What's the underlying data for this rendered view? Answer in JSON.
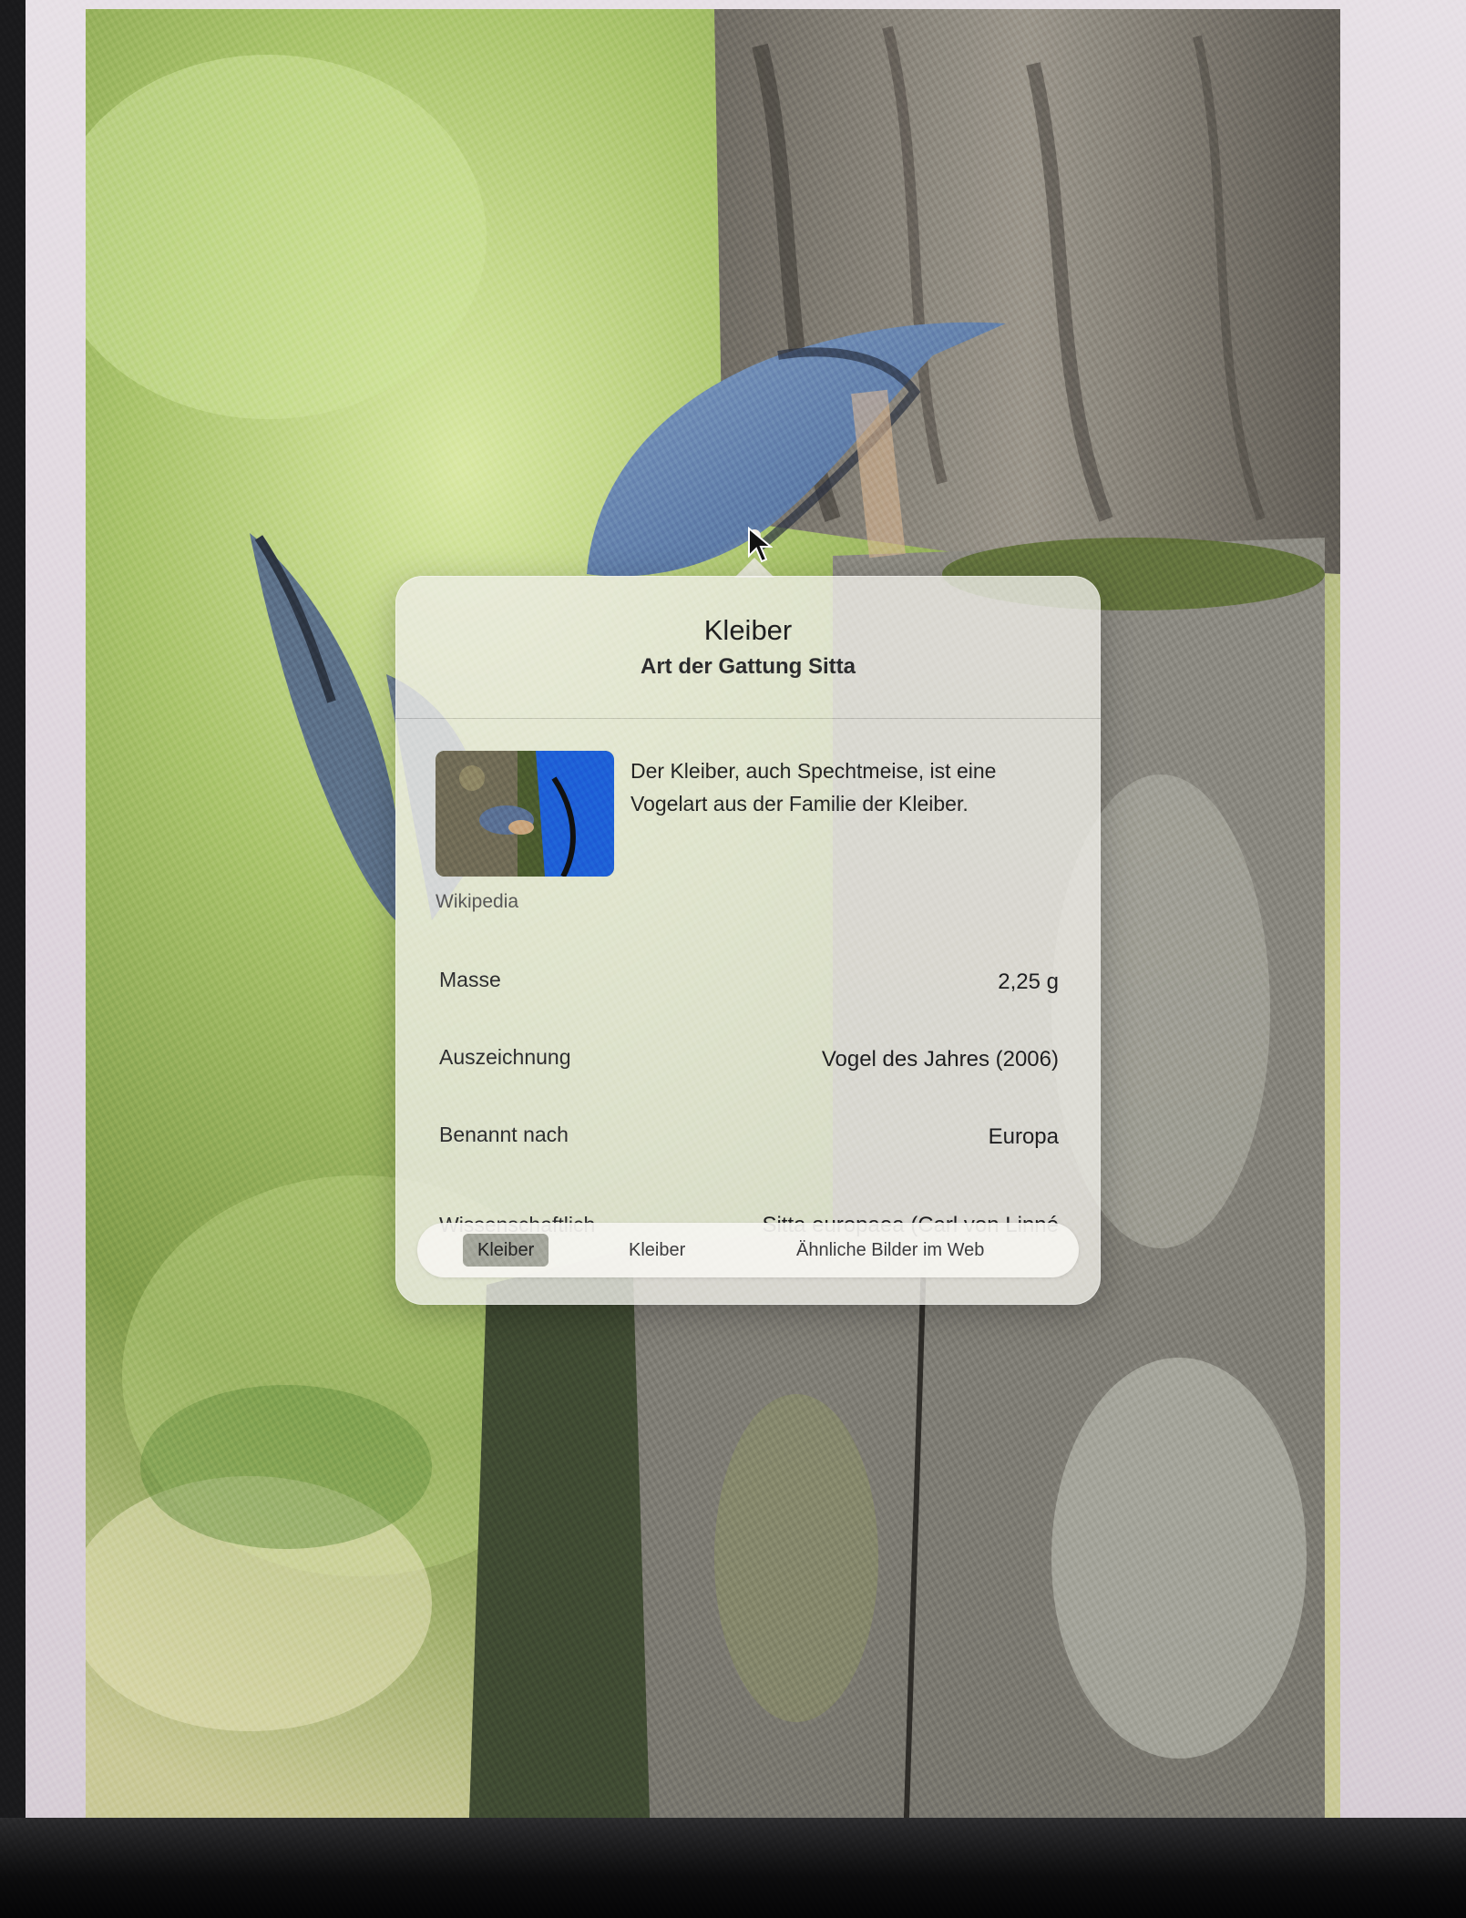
{
  "popover": {
    "title": "Kleiber",
    "subtitle": "Art der Gattung Sitta",
    "summary": "Der Kleiber, auch Spechtmeise, ist eine Vogelart aus der Familie der Kleiber.",
    "source": "Wikipedia",
    "facts": [
      {
        "label": "Masse",
        "value": "2,25 g"
      },
      {
        "label": "Auszeichnung",
        "value": "Vogel des Jahres (2006)"
      },
      {
        "label": "Benannt nach",
        "value": "Europa"
      },
      {
        "label": "Wissenschaftlich",
        "value": "Sitta europaea (Carl von Linné"
      }
    ],
    "tabs": [
      {
        "label": "Kleiber",
        "active": true
      },
      {
        "label": "Kleiber",
        "active": false
      },
      {
        "label": "Ähnliche Bilder im Web",
        "active": false
      }
    ]
  },
  "colors": {
    "popover_bg": "#eeece6",
    "active_tab": "#a3a59a",
    "foliage": "#a8c46a",
    "bark": "#8e8980"
  },
  "icons": {
    "cursor": "arrow-pointer-icon",
    "lookup_dot": "visual-lookup-dot-icon"
  }
}
